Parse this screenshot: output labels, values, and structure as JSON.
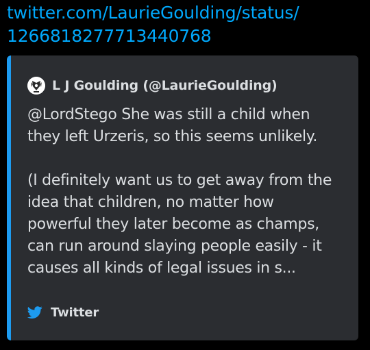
{
  "message": {
    "link_line1": "twitter.com/LaurieGoulding/status/",
    "link_line2": "1266818277713440768"
  },
  "embed": {
    "accent_color": "#1d9bf0",
    "author": {
      "name": "L J Goulding (@LaurieGoulding)",
      "avatar_icon": "avatar-crest-icon"
    },
    "description": [
      "@LordStego She was still a child when",
      "they left Urzeris, so this seems unlikely.",
      "",
      "(I definitely want us to get away from the",
      "idea that children, no matter how",
      "powerful they later become as champs,",
      "can run around slaying people easily - it",
      "causes all kinds of legal issues in s..."
    ],
    "footer": {
      "icon": "twitter-bird-icon",
      "text": "Twitter"
    }
  }
}
